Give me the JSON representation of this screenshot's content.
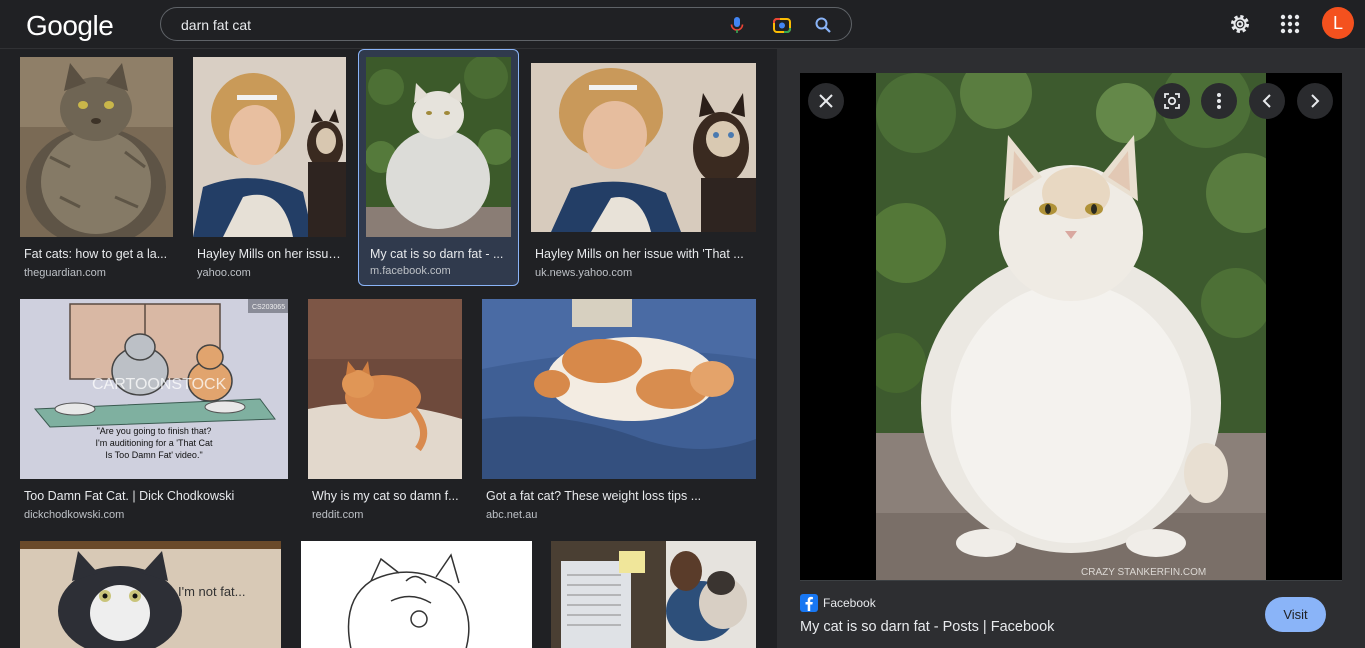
{
  "header": {
    "logo": "Google",
    "search_value": "darn fat cat",
    "avatar_letter": "L"
  },
  "results": [
    {
      "title": "Fat cats: how to get a la...",
      "source": "theguardian.com"
    },
    {
      "title": "Hayley Mills on her issue...",
      "source": "yahoo.com"
    },
    {
      "title": "My cat is so darn fat - ...",
      "source": "m.facebook.com"
    },
    {
      "title": "Hayley Mills on her issue with 'That ...",
      "source": "uk.news.yahoo.com"
    },
    {
      "title": "Too Damn Fat Cat. | Dick Chodkowski",
      "source": "dickchodkowski.com"
    },
    {
      "title": "Why is my cat so damn f...",
      "source": "reddit.com"
    },
    {
      "title": "Got a fat cat? These weight loss tips ...",
      "source": "abc.net.au"
    }
  ],
  "thumb_text": {
    "cartoon_caption_1": "\"Are you going to finish that?",
    "cartoon_caption_2": "I'm auditioning for a 'That Cat",
    "cartoon_caption_3": "Is Too Damn Fat' video.\"",
    "cartoon_watermark": "CARTOONSTOCK",
    "cartoon_id": "CS203065",
    "not_fat": "I'm not fat..."
  },
  "preview": {
    "source": "Facebook",
    "title": "My cat is so darn fat - Posts | Facebook",
    "visit_label": "Visit",
    "watermark": "CRAZY STANKERFIN.COM"
  },
  "colors": {
    "accent": "#8ab4f8",
    "avatar": "#f4511e",
    "facebook": "#1877f2"
  }
}
